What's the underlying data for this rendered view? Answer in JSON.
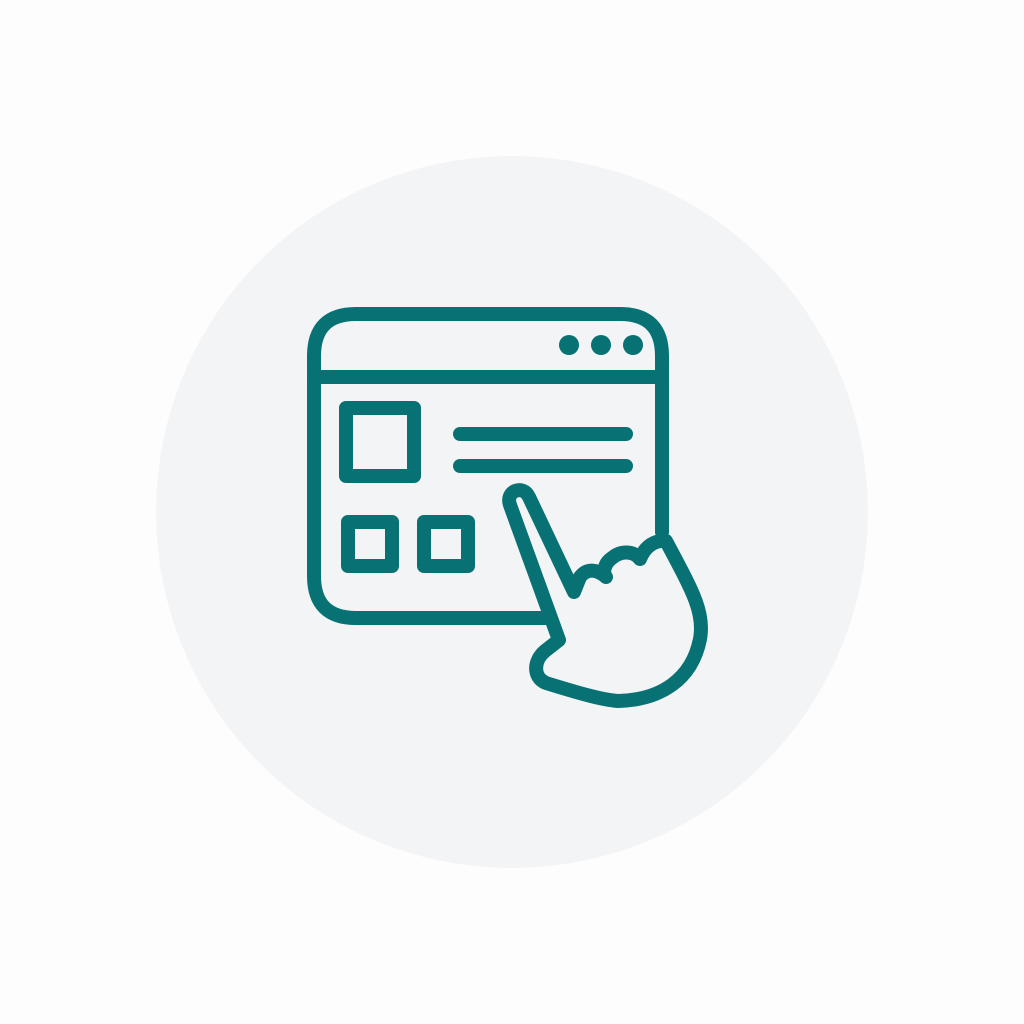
{
  "icon": {
    "name": "web-interaction-icon",
    "depicts": [
      "browser-window-icon",
      "pointing-hand-icon"
    ]
  },
  "colors": {
    "background": "#fdfdfd",
    "badge": "#f3f4f6",
    "stroke": "#077174"
  }
}
